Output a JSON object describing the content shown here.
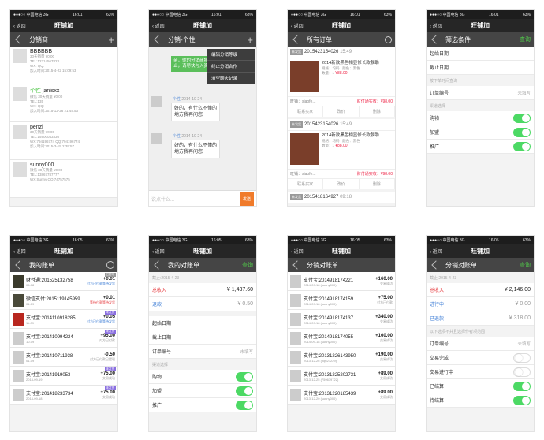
{
  "status": {
    "carrier": "●●●○○ 中国电信 3G",
    "time1": "16:01",
    "time2": "16:05",
    "battery": "63%"
  },
  "nav": {
    "back": "返回",
    "app_title": "旺铺加",
    "save": "查询"
  },
  "screen1": {
    "title": "分销商",
    "users": [
      {
        "name": "BBBBBB",
        "tag": "",
        "l1": "30天销量 ¥0.00",
        "l2": "TEL:12314567823",
        "l3": "WX: QQ:",
        "l4": "加入时间:2015-4-22 15:09:53"
      },
      {
        "name": "janisxx",
        "tag": "个性",
        "l1": "微信 30天销量 ¥0.00",
        "l2": "TEL:135",
        "l3": "WX: QQ:",
        "l4": "加入时间:2015-12-26 21:44:53"
      },
      {
        "name": "penzi",
        "tag": "",
        "l1": "30天销量 ¥0.00",
        "l2": "TEL:15900043336",
        "l3": "WX:794196774 QQ:794196774",
        "l4": "加入时间:2015-3-15 2:39:57"
      },
      {
        "name": "sunny000",
        "tag": "",
        "l1": "微信 30天销量 ¥0.00",
        "l2": "TEL:13867787777",
        "l3": "WX:Sunny QQ:74757575",
        "l4": ""
      }
    ]
  },
  "screen2": {
    "title": "分销-个性",
    "green_msg": "亲，你的分销商将被终止，请尽快与入资...",
    "menu": [
      "编辑分销等级",
      "终止分销合作",
      "清空聊天记录"
    ],
    "msgs": [
      {
        "name": "个性",
        "time": "2014-10-24",
        "text": "好的，有什么不懂的地方我再问您"
      },
      {
        "name": "个性",
        "time": "2014-10-24",
        "text": "好的，有什么不懂的地方我再问您"
      }
    ],
    "placeholder": "说点什么...",
    "send": "发送"
  },
  "screen3": {
    "title": "所有订单",
    "orders": [
      {
        "no": "2015423154026",
        "time": "15:49",
        "title": "2014新款黑色相显修长款款助",
        "meta": "规格：均码 | 颜色：黑色",
        "qty": "数量：1",
        "price": "¥88.00",
        "seller": "旺铺：siaofe...",
        "profit": "财付通实收：¥98.00",
        "btn1": "联系买家",
        "btn2": "改价",
        "btn3": "删除"
      },
      {
        "no": "2015423154026",
        "time": "15:49",
        "title": "2014新款黑色相显修长款款助",
        "meta": "规格：均码 | 颜色：黑色",
        "qty": "数量：1",
        "price": "¥88.00",
        "seller": "旺铺：siaofe...",
        "profit": "财付通实收：¥98.00",
        "btn1": "联系买家",
        "btn2": "改价",
        "btn3": "删除"
      },
      {
        "no": "2015418164927",
        "time": "09:18",
        "title": "",
        "meta": "",
        "qty": "",
        "price": "",
        "seller": "",
        "profit": "",
        "btn1": "",
        "btn2": "",
        "btn3": ""
      }
    ]
  },
  "screen4": {
    "title": "筛选条件",
    "start": "起始日期",
    "end": "截止日期",
    "hint1": "按下单时间查询",
    "order_no": "订单编号",
    "unfilled": "未填写",
    "section": "渠道选择",
    "toggles": [
      {
        "label": "购物",
        "on": true
      },
      {
        "label": "加盟",
        "on": true
      },
      {
        "label": "推广",
        "on": true
      }
    ]
  },
  "screen5": {
    "title": "我的账单",
    "rows": [
      {
        "title": "财付通:201525132758",
        "date": "05-08",
        "amt": "+0.01",
        "status": "对方已付款等待发货",
        "badge": "已打印"
      },
      {
        "title": "微信支付:2015119145959",
        "date": "01-19",
        "amt": "+0.01",
        "status": "等待付款等待发货",
        "badge": ""
      },
      {
        "title": "支付宝:2014110918285",
        "date": "11-09",
        "amt": "+0.05",
        "status": "对方已付款等待发货",
        "badge": "未发货"
      },
      {
        "title": "支付宝:201410994224",
        "date": "10-09",
        "amt": "+95.00",
        "status": "对方已付款",
        "badge": "未发货"
      },
      {
        "title": "支付宝:201410711938",
        "date": "01-09",
        "amt": "-0.50",
        "status": "对方已付款已提现",
        "badge": ""
      },
      {
        "title": "支付宝:20141919053",
        "date": "2014-09-19",
        "amt": "+75.00",
        "status": "交易成功",
        "badge": "未发货"
      },
      {
        "title": "支付宝:201418233734",
        "date": "2014-09-18",
        "amt": "+75.00",
        "status": "交易成功",
        "badge": "未发货"
      }
    ]
  },
  "screen6": {
    "title": "我的对账单",
    "save": "查询",
    "cutoff": "截止:2015-4-23",
    "income_label": "总收入",
    "income": "¥ 1,437.60",
    "refund_label": "退款",
    "refund": "¥ 0.50",
    "start": "起始日期",
    "end": "截止日期",
    "order_no": "订单编号",
    "unfilled": "未填写",
    "section": "渠道选择",
    "toggles": [
      {
        "label": "购物",
        "on": true
      },
      {
        "label": "加盟",
        "on": true
      },
      {
        "label": "推广",
        "on": true
      }
    ]
  },
  "screen7": {
    "title": "分销对账单",
    "rows": [
      {
        "title": "支付宝:2014918174221",
        "date": "2014-09-18",
        "who": "(sunny000)",
        "amt": "+160.00",
        "status": "交易成功"
      },
      {
        "title": "支付宝:2014918174159",
        "date": "2014-09-18",
        "who": "(sunny000)",
        "amt": "+75.00",
        "status": "对方已付款"
      },
      {
        "title": "支付宝:2014918174137",
        "date": "2014-09-18",
        "who": "(sunny000)",
        "amt": "+340.00",
        "status": "交易成功"
      },
      {
        "title": "支付宝:2014918174055",
        "date": "2014-09-18",
        "who": "(sunny000)",
        "amt": "+160.00",
        "status": "交易成功"
      },
      {
        "title": "支付宝:20131226143950",
        "date": "2013-12-26",
        "who": "(bq621229)",
        "amt": "+190.00",
        "status": "交易成功"
      },
      {
        "title": "支付宝:20131225202731",
        "date": "2013-12-25",
        "who": "(759639722)",
        "amt": "+89.00",
        "status": "交易成功"
      },
      {
        "title": "支付宝:20131220185439",
        "date": "2013-12-20",
        "who": "(sunny000)",
        "amt": "+89.00",
        "status": "交易成功"
      }
    ]
  },
  "screen8": {
    "title": "分销对账单",
    "save": "查询",
    "cutoff": "截止:2015-4-23",
    "income_label": "总收入",
    "income": "¥ 2,146.00",
    "pending_label": "进行中",
    "pending": "¥ 0.00",
    "refund_label": "已退款",
    "refund": "¥ 318.00",
    "hint": "以下选项不并且选择作者项范围",
    "order_no": "订单编号",
    "unfilled": "未填写",
    "toggles": [
      {
        "label": "交易完成",
        "on": false
      },
      {
        "label": "交易进行中",
        "on": false
      },
      {
        "label": "已结算",
        "on": true
      },
      {
        "label": "待结算",
        "on": true
      }
    ]
  }
}
